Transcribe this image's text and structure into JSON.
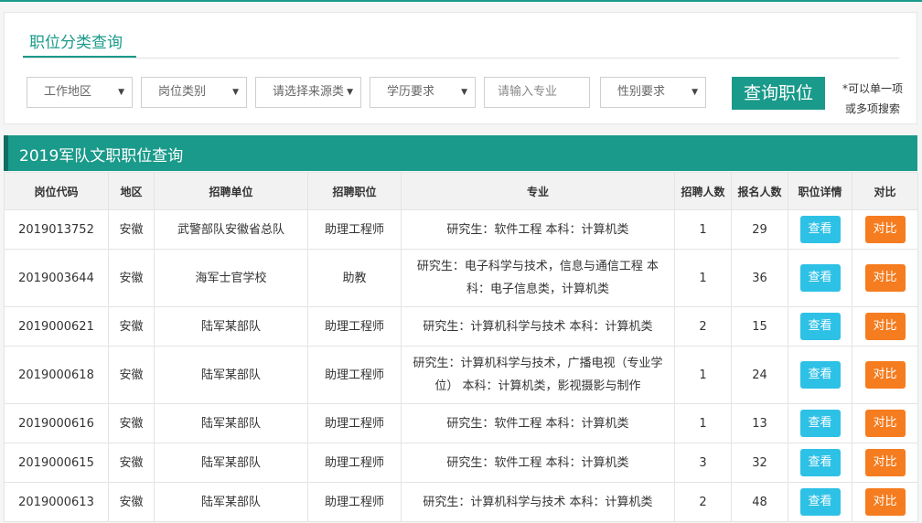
{
  "filters": {
    "title": "职位分类查询",
    "region": "工作地区",
    "category": "岗位类别",
    "source": "请选择来源类",
    "education": "学历要求",
    "major_placeholder": "请输入专业",
    "gender": "性别要求",
    "query_label": "查询职位",
    "hint_line1": "*可以单一项",
    "hint_line2": "或多项搜索"
  },
  "section": {
    "title": "2019军队文职职位查询"
  },
  "table": {
    "headers": [
      "岗位代码",
      "地区",
      "招聘单位",
      "招聘职位",
      "专业",
      "招聘人数",
      "报名人数",
      "职位详情",
      "对比"
    ],
    "rows": [
      {
        "code": "2019013752",
        "region": "安徽",
        "unit": "武警部队安徽省总队",
        "position": "助理工程师",
        "major": "研究生：软件工程 本科：计算机类",
        "quota": "1",
        "applicants": "29",
        "view": "查看",
        "compare": "对比"
      },
      {
        "code": "2019003644",
        "region": "安徽",
        "unit": "海军士官学校",
        "position": "助教",
        "major": "研究生：电子科学与技术，信息与通信工程 本科：电子信息类，计算机类",
        "quota": "1",
        "applicants": "36",
        "view": "查看",
        "compare": "对比"
      },
      {
        "code": "2019000621",
        "region": "安徽",
        "unit": "陆军某部队",
        "position": "助理工程师",
        "major": "研究生：计算机科学与技术 本科：计算机类",
        "quota": "2",
        "applicants": "15",
        "view": "查看",
        "compare": "对比"
      },
      {
        "code": "2019000618",
        "region": "安徽",
        "unit": "陆军某部队",
        "position": "助理工程师",
        "major": "研究生：计算机科学与技术，广播电视（专业学位） 本科：计算机类，影视摄影与制作",
        "quota": "1",
        "applicants": "24",
        "view": "查看",
        "compare": "对比"
      },
      {
        "code": "2019000616",
        "region": "安徽",
        "unit": "陆军某部队",
        "position": "助理工程师",
        "major": "研究生：软件工程 本科：计算机类",
        "quota": "1",
        "applicants": "13",
        "view": "查看",
        "compare": "对比"
      },
      {
        "code": "2019000615",
        "region": "安徽",
        "unit": "陆军某部队",
        "position": "助理工程师",
        "major": "研究生：软件工程 本科：计算机类",
        "quota": "3",
        "applicants": "32",
        "view": "查看",
        "compare": "对比"
      },
      {
        "code": "2019000613",
        "region": "安徽",
        "unit": "陆军某部队",
        "position": "助理工程师",
        "major": "研究生：计算机科学与技术 本科：计算机类",
        "quota": "2",
        "applicants": "48",
        "view": "查看",
        "compare": "对比"
      }
    ]
  },
  "colors": {
    "accent": "#1a9a8a",
    "view_button": "#2ec1e6",
    "compare_button": "#f57c1f"
  },
  "icons": {
    "dropdown": "caret-down-icon"
  }
}
